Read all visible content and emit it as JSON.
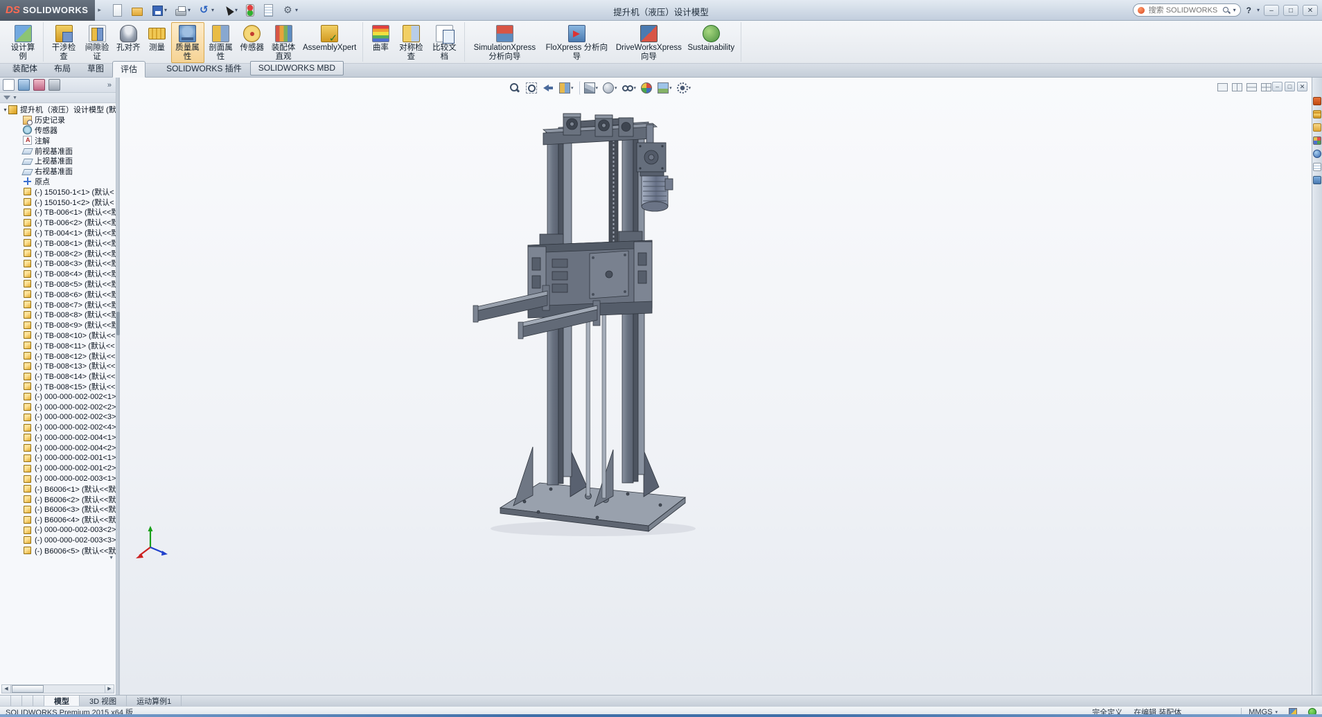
{
  "window": {
    "logo_mark": "DS",
    "logo_name": "SOLIDWORKS",
    "menu_arrow": "▸",
    "title": "提升机（液压）设计模型",
    "search_placeholder": "搜索 SOLIDWORKS 帮助",
    "search_caret": "▾",
    "help_label": "?",
    "help_caret": "▾",
    "minimize": "–",
    "maximize": "□",
    "close": "✕"
  },
  "quick_access": [
    {
      "name": "new-document",
      "icon": "qa-new",
      "caret": ""
    },
    {
      "name": "open",
      "icon": "qa-open",
      "caret": ""
    },
    {
      "name": "save",
      "icon": "qa-save",
      "caret": "▾"
    },
    {
      "name": "print",
      "icon": "qa-print",
      "caret": "▾"
    },
    {
      "name": "undo",
      "icon": "qa-undo",
      "caret": "▾"
    },
    {
      "name": "select",
      "icon": "qa-select",
      "caret": "▾"
    },
    {
      "name": "rebuild",
      "icon": "qa-rebuild",
      "caret": ""
    },
    {
      "name": "file-properties",
      "icon": "qa-props",
      "caret": ""
    },
    {
      "name": "options",
      "icon": "qa-options",
      "caret": "▾"
    }
  ],
  "ribbon": {
    "groups": [
      {
        "buttons": [
          {
            "label": "设计算例",
            "icon": "design-study"
          }
        ]
      },
      {
        "buttons": [
          {
            "label": "干涉检查",
            "icon": "interference-detection"
          },
          {
            "label": "间隙验证",
            "icon": "clearance-verification"
          },
          {
            "label": "孔对齐",
            "icon": "hole-alignment"
          },
          {
            "label": "测量",
            "icon": "measure"
          },
          {
            "label": "质量属性",
            "icon": "mass-properties",
            "active": true
          },
          {
            "label": "剖面属性",
            "icon": "section-properties"
          },
          {
            "label": "传感器",
            "icon": "sensor"
          },
          {
            "label": "装配体直观",
            "icon": "assembly-visualization"
          },
          {
            "label": "AssemblyXpert",
            "icon": "assemblyxpert",
            "cls": "wide"
          }
        ]
      },
      {
        "buttons": [
          {
            "label": "曲率",
            "icon": "curvature"
          },
          {
            "label": "对称检查",
            "icon": "symmetry-check"
          },
          {
            "label": "比较文档",
            "icon": "compare-documents"
          }
        ]
      },
      {
        "buttons": [
          {
            "label": "SimulationXpress 分析向导",
            "icon": "simulationxpress",
            "cls": "wide"
          },
          {
            "label": "FloXpress 分析向导",
            "icon": "floxpress",
            "cls": "wide"
          },
          {
            "label": "DriveWorksXpress 向导",
            "icon": "driveworksxpress",
            "cls": "wide"
          },
          {
            "label": "Sustainability",
            "icon": "sustainability",
            "cls": "wide"
          }
        ]
      }
    ]
  },
  "command_tabs": [
    {
      "label": "装配体"
    },
    {
      "label": "布局"
    },
    {
      "label": "草图"
    },
    {
      "label": "评估",
      "active": true
    },
    {
      "label": "SOLIDWORKS 插件",
      "cls": "gap"
    },
    {
      "label": "SOLIDWORKS MBD",
      "cls": "boxed"
    }
  ],
  "hud": [
    {
      "name": "zoom-fit",
      "icon": "hud-zoom-fit",
      "caret": ""
    },
    {
      "name": "zoom-area",
      "icon": "hud-zoom-area",
      "caret": ""
    },
    {
      "name": "previous-view",
      "icon": "hud-previous-view",
      "caret": ""
    },
    {
      "name": "section-view",
      "icon": "hud-section",
      "caret": "▾"
    },
    {
      "name": "view-orientation",
      "icon": "hud-orientation",
      "caret": "▾",
      "cls": "sep"
    },
    {
      "name": "display-style",
      "icon": "hud-display-style",
      "caret": "▾"
    },
    {
      "name": "hide-show-items",
      "icon": "hud-hide-show",
      "caret": "▾"
    },
    {
      "name": "edit-appearance",
      "icon": "hud-appearance",
      "caret": ""
    },
    {
      "name": "apply-scene",
      "icon": "hud-scene",
      "caret": "▾"
    },
    {
      "name": "view-settings",
      "icon": "hud-settings",
      "caret": "▾"
    }
  ],
  "viewport_splits": [
    {
      "name": "viewport-single",
      "cls": "s1"
    },
    {
      "name": "viewport-two-vertical",
      "cls": "v2"
    },
    {
      "name": "viewport-two-horizontal",
      "cls": "h2"
    },
    {
      "name": "viewport-four",
      "cls": "v4"
    }
  ],
  "doc_window": {
    "minimize": "–",
    "restore": "□",
    "close": "✕"
  },
  "panel": {
    "manager_tabs": [
      {
        "name": "featuremanager-design-tree",
        "icon": "mgr-tree",
        "active": true
      },
      {
        "name": "propertymanager",
        "icon": "mgr-prop"
      },
      {
        "name": "configurationmanager",
        "icon": "mgr-config"
      },
      {
        "name": "dimxpertmanager",
        "icon": "mgr-dim"
      }
    ],
    "overflow": "»",
    "filter_caret": "▼",
    "hscroll": {
      "left": "◀",
      "right": "▶"
    },
    "tree": {
      "scroll_up": "▲",
      "scroll_down": "▼",
      "rows": [
        {
          "exp": "▾",
          "icon": "t-asm",
          "label": "提升机（液压）设计模型 (默",
          "cls": "root"
        },
        {
          "exp": "",
          "icon": "t-hist",
          "label": "历史记录"
        },
        {
          "exp": "",
          "icon": "t-sensor",
          "label": "传感器"
        },
        {
          "exp": "",
          "icon": "t-ann",
          "label": "注解"
        },
        {
          "exp": "",
          "icon": "t-plane",
          "label": "前视基准面"
        },
        {
          "exp": "",
          "icon": "t-plane",
          "label": "上视基准面"
        },
        {
          "exp": "",
          "icon": "t-plane",
          "label": "右视基准面"
        },
        {
          "exp": "",
          "icon": "t-origin",
          "label": "原点"
        },
        {
          "exp": "",
          "icon": "t-part",
          "label": "(-) 150150-1<1> (默认<"
        },
        {
          "exp": "",
          "icon": "t-part",
          "label": "(-) 150150-1<2> (默认<"
        },
        {
          "exp": "",
          "icon": "t-part",
          "label": "(-) TB-006<1> (默认<<默"
        },
        {
          "exp": "",
          "icon": "t-part",
          "label": "(-) TB-006<2> (默认<<默"
        },
        {
          "exp": "",
          "icon": "t-part",
          "label": "(-) TB-004<1> (默认<<默"
        },
        {
          "exp": "",
          "icon": "t-part",
          "label": "(-) TB-008<1> (默认<<默"
        },
        {
          "exp": "",
          "icon": "t-part",
          "label": "(-) TB-008<2> (默认<<默"
        },
        {
          "exp": "",
          "icon": "t-part",
          "label": "(-) TB-008<3> (默认<<默"
        },
        {
          "exp": "",
          "icon": "t-part",
          "label": "(-) TB-008<4> (默认<<默"
        },
        {
          "exp": "",
          "icon": "t-part",
          "label": "(-) TB-008<5> (默认<<默"
        },
        {
          "exp": "",
          "icon": "t-part",
          "label": "(-) TB-008<6> (默认<<默"
        },
        {
          "exp": "",
          "icon": "t-part",
          "label": "(-) TB-008<7> (默认<<默"
        },
        {
          "exp": "",
          "icon": "t-part",
          "label": "(-) TB-008<8> (默认<<默"
        },
        {
          "exp": "",
          "icon": "t-part",
          "label": "(-) TB-008<9> (默认<<默"
        },
        {
          "exp": "",
          "icon": "t-part",
          "label": "(-) TB-008<10> (默认<<"
        },
        {
          "exp": "",
          "icon": "t-part",
          "label": "(-) TB-008<11> (默认<<"
        },
        {
          "exp": "",
          "icon": "t-part",
          "label": "(-) TB-008<12> (默认<<"
        },
        {
          "exp": "",
          "icon": "t-part",
          "label": "(-) TB-008<13> (默认<<"
        },
        {
          "exp": "",
          "icon": "t-part",
          "label": "(-) TB-008<14> (默认<<"
        },
        {
          "exp": "",
          "icon": "t-part",
          "label": "(-) TB-008<15> (默认<<"
        },
        {
          "exp": "",
          "icon": "t-part",
          "label": "(-) 000-000-002-002<1>"
        },
        {
          "exp": "",
          "icon": "t-part",
          "label": "(-) 000-000-002-002<2>"
        },
        {
          "exp": "",
          "icon": "t-part",
          "label": "(-) 000-000-002-002<3>"
        },
        {
          "exp": "",
          "icon": "t-part",
          "label": "(-) 000-000-002-002<4>"
        },
        {
          "exp": "",
          "icon": "t-part",
          "label": "(-) 000-000-002-004<1>"
        },
        {
          "exp": "",
          "icon": "t-part",
          "label": "(-) 000-000-002-004<2>"
        },
        {
          "exp": "",
          "icon": "t-part",
          "label": "(-) 000-000-002-001<1>"
        },
        {
          "exp": "",
          "icon": "t-part",
          "label": "(-) 000-000-002-001<2>"
        },
        {
          "exp": "",
          "icon": "t-part",
          "label": "(-) 000-000-002-003<1>"
        },
        {
          "exp": "",
          "icon": "t-part",
          "label": "(-) B6006<1> (默认<<默"
        },
        {
          "exp": "",
          "icon": "t-part",
          "label": "(-) B6006<2> (默认<<默"
        },
        {
          "exp": "",
          "icon": "t-part",
          "label": "(-) B6006<3> (默认<<默"
        },
        {
          "exp": "",
          "icon": "t-part",
          "label": "(-) B6006<4> (默认<<默"
        },
        {
          "exp": "",
          "icon": "t-part",
          "label": "(-) 000-000-002-003<2>"
        },
        {
          "exp": "",
          "icon": "t-part",
          "label": "(-) 000-000-002-003<3>"
        },
        {
          "exp": "",
          "icon": "t-part",
          "label": "(-) B6006<5> (默认<<默"
        }
      ]
    }
  },
  "taskpane": [
    {
      "name": "solidworks-resources",
      "icon": "tp-home"
    },
    {
      "name": "design-library",
      "icon": "tp-library"
    },
    {
      "name": "file-explorer",
      "icon": "tp-folder"
    },
    {
      "name": "view-palette",
      "icon": "tp-palette"
    },
    {
      "name": "appearances-scenes",
      "icon": "tp-appearance"
    },
    {
      "name": "custom-properties",
      "icon": "tp-props"
    },
    {
      "name": "solidworks-forum",
      "icon": "tp-forum"
    }
  ],
  "doc_tabs": {
    "nav": [
      "|◀",
      "◀",
      "▶",
      "▶|"
    ],
    "tabs": [
      {
        "label": "模型",
        "active": true
      },
      {
        "label": "3D 视图"
      },
      {
        "label": "运动算例1"
      }
    ]
  },
  "statusbar": {
    "product": "SOLIDWORKS Premium 2015 x64 版",
    "state": "完全定义",
    "editing": "在编辑 装配体",
    "units": "MMGS",
    "units_caret": "▾"
  }
}
